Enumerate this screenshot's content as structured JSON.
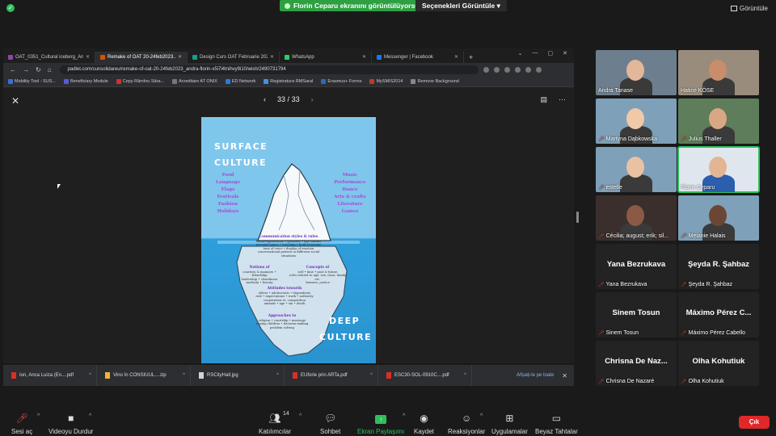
{
  "topbar": {
    "share_text": "Florin Ceparu ekranını görüntülüyorsunuz",
    "view_options": "Seçenekleri Görüntüle",
    "view_button": "Görüntüle"
  },
  "browser": {
    "tabs": [
      {
        "label": "OAT_0351_Cultural iceberg_Ana",
        "color": "#8e44ad"
      },
      {
        "label": "Remake of OAT 20-24feb2023...",
        "color": "#d35400",
        "active": true
      },
      {
        "label": "Design Curs OAT Februarie 202...",
        "color": "#16a085"
      },
      {
        "label": "WhatsApp",
        "color": "#25d366"
      },
      {
        "label": "Messenger | Facebook",
        "color": "#1877f2"
      }
    ],
    "url": "padlet.com/sunsolidareu/remake-of-oat-20-24feb2023_andra-florin-x5i7i4tnihvy9i10/wish/2490731794",
    "bookmarks": [
      {
        "label": "Mobility Tool - SUS...",
        "color": "#3b6fd8"
      },
      {
        "label": "Beneficiary Module",
        "color": "#5a5ad6"
      },
      {
        "label": "Cepy Rămînu Săra...",
        "color": "#cc3333"
      },
      {
        "label": "Acreditare AT ONIX",
        "color": "#777777"
      },
      {
        "label": "ED Network",
        "color": "#2b7bd6"
      },
      {
        "label": "Registratura RMSaraI",
        "color": "#4a90d9"
      },
      {
        "label": "Erasmus+ Forms",
        "color": "#2b6cb0"
      },
      {
        "label": "MySMIS2014",
        "color": "#c0392b"
      },
      {
        "label": "Remove Background",
        "color": "#888888"
      }
    ],
    "pager": {
      "current": "33",
      "separator": "/",
      "total": "33"
    }
  },
  "slide": {
    "surface_title_1": "SURFACE",
    "surface_title_2": "CULTURE",
    "left_list": [
      "Food",
      "Language",
      "Flags",
      "Festivals",
      "Fashion",
      "Holidays"
    ],
    "right_list": [
      "Music",
      "Performance",
      "Dance",
      "Arts & crafts",
      "Literature",
      "Games"
    ],
    "deep_title_1": "DEEP",
    "deep_title_2": "CULTURE",
    "under_blocks": [
      {
        "heading": "Communication styles & rules",
        "lines": [
          "Facial expressions • gestures • eye contact",
          "personal space • touching • body language",
          "tone of voice • display of emotion",
          "conversational pattern in different social",
          "situations"
        ]
      },
      {
        "heading": "Notions of",
        "lines": [
          "courtesy & manners • friendship",
          "leadership • cleanliness",
          "modesty • beauty"
        ]
      },
      {
        "heading": "Concepts of",
        "lines": [
          "self • time • past & future",
          "roles related to age, sex, class, family etc.",
          "fairness, justice"
        ]
      },
      {
        "heading": "Attitudes towards",
        "lines": [
          "elders • adolescents • dependents",
          "rule • expectations • work • authority",
          "cooperation vs. competition",
          "animals • age • sin • death"
        ]
      },
      {
        "heading": "Approaches to",
        "lines": [
          "religion • courtship • marriage",
          "raising children • decision-making",
          "problem solving"
        ]
      }
    ]
  },
  "downloads": {
    "items": [
      {
        "name": "Ion, Anca Luiza (En....pdf",
        "type": "pdf"
      },
      {
        "name": "Vino în CONSIUUL....zip",
        "type": "zip"
      },
      {
        "name": "RSCityHall.jpg",
        "type": "jpg"
      },
      {
        "name": "EUforie prin ARTa.pdf",
        "type": "pdf"
      },
      {
        "name": "ESC30-SOL-0910C....pdf",
        "type": "pdf"
      }
    ],
    "show_all": "Afișați-le pe toate"
  },
  "participants": [
    {
      "name": "Andra Tanase",
      "video": true,
      "muted": false
    },
    {
      "name": "Hatice KÖSE",
      "video": true,
      "muted": false
    },
    {
      "name": "Martyna Dąbkowska",
      "video": true,
      "muted": true
    },
    {
      "name": "Julius Thaller",
      "video": true,
      "muted": true
    },
    {
      "name": "estelle",
      "video": true,
      "muted": true
    },
    {
      "name": "Florin Ceparu",
      "video": true,
      "muted": false,
      "speaking": true
    },
    {
      "name": "Cécilia; august; erik; sil...",
      "video": true,
      "muted": true
    },
    {
      "name": "Mélanie Halais",
      "video": true,
      "muted": true
    },
    {
      "name": "Yana Bezrukava",
      "display": "Yana Bezrukava",
      "video": false,
      "muted": true
    },
    {
      "name": "Şeyda R. Şahbaz",
      "display": "Şeyda R. Şahbaz",
      "video": false,
      "muted": true
    },
    {
      "name": "Sinem Tosun",
      "display": "Sinem Tosun",
      "video": false,
      "muted": true
    },
    {
      "name": "Máximo Pérez Cabello",
      "display": "Máximo Pérez C...",
      "video": false,
      "muted": true
    },
    {
      "name": "Chrisna De Nazaré",
      "display": "Chrisna De Naz...",
      "video": false,
      "muted": true
    },
    {
      "name": "Olha Kohutiuk",
      "display": "Olha Kohutiuk",
      "video": false,
      "muted": true
    }
  ],
  "toolbar": {
    "mute": "Sesi aç",
    "video": "Videoyu Durdur",
    "participants": "Katılımcılar",
    "participant_count": "14",
    "chat": "Sohbet",
    "share": "Ekran Paylaşımı",
    "record": "Kaydet",
    "reactions": "Reaksiyonlar",
    "apps": "Uygulamalar",
    "whiteboard": "Beyaz Tahtalar",
    "leave": "Çık"
  },
  "colors": {
    "accent_green": "#2fbf5a",
    "leave_red": "#e02828",
    "slide_purple": "#a64bd6"
  }
}
